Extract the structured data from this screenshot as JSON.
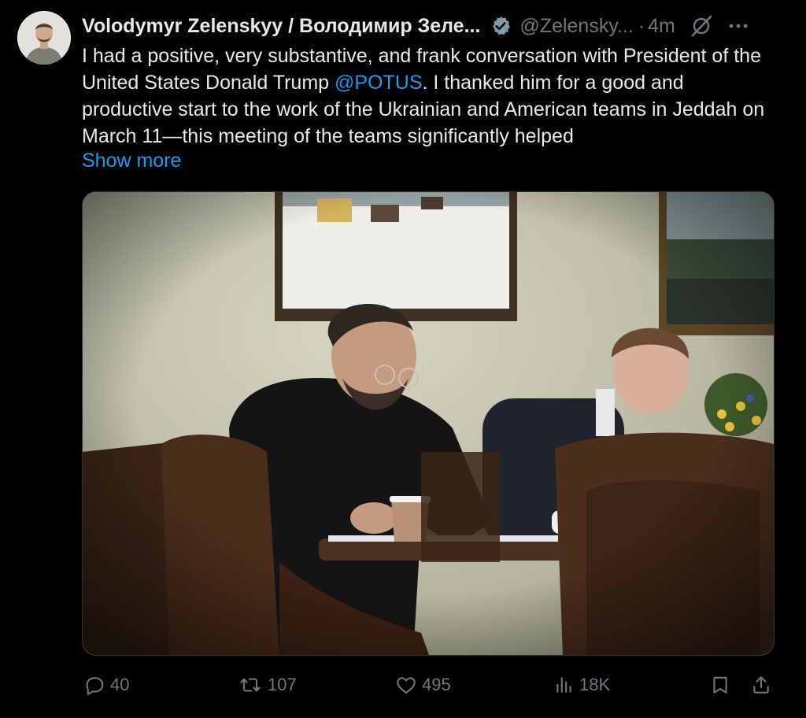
{
  "tweet": {
    "author_name": "Volodymyr Zelenskyy / Володимир Зеле...",
    "handle": "@Zelensky...",
    "separator": "·",
    "time": "4m",
    "text_before_mention": "I had a positive, very substantive, and frank conversation with President of the United States Donald Trump ",
    "mention": "@POTUS",
    "text_after_mention": ". I thanked him for a good and productive start to the work of the Ukrainian and American teams in Jeddah on March 11—this meeting of the teams significantly helped",
    "show_more": "Show more"
  },
  "stats": {
    "replies": "40",
    "reposts": "107",
    "likes": "495",
    "views": "18K"
  },
  "colors": {
    "background": "#000000",
    "text": "#e7e9ea",
    "muted": "#71767b",
    "link": "#1d9bf0"
  },
  "icons": [
    "verified-badge-icon",
    "grok-icon",
    "more-options-icon",
    "reply-icon",
    "repost-icon",
    "like-icon",
    "views-icon",
    "bookmark-icon",
    "share-icon"
  ]
}
